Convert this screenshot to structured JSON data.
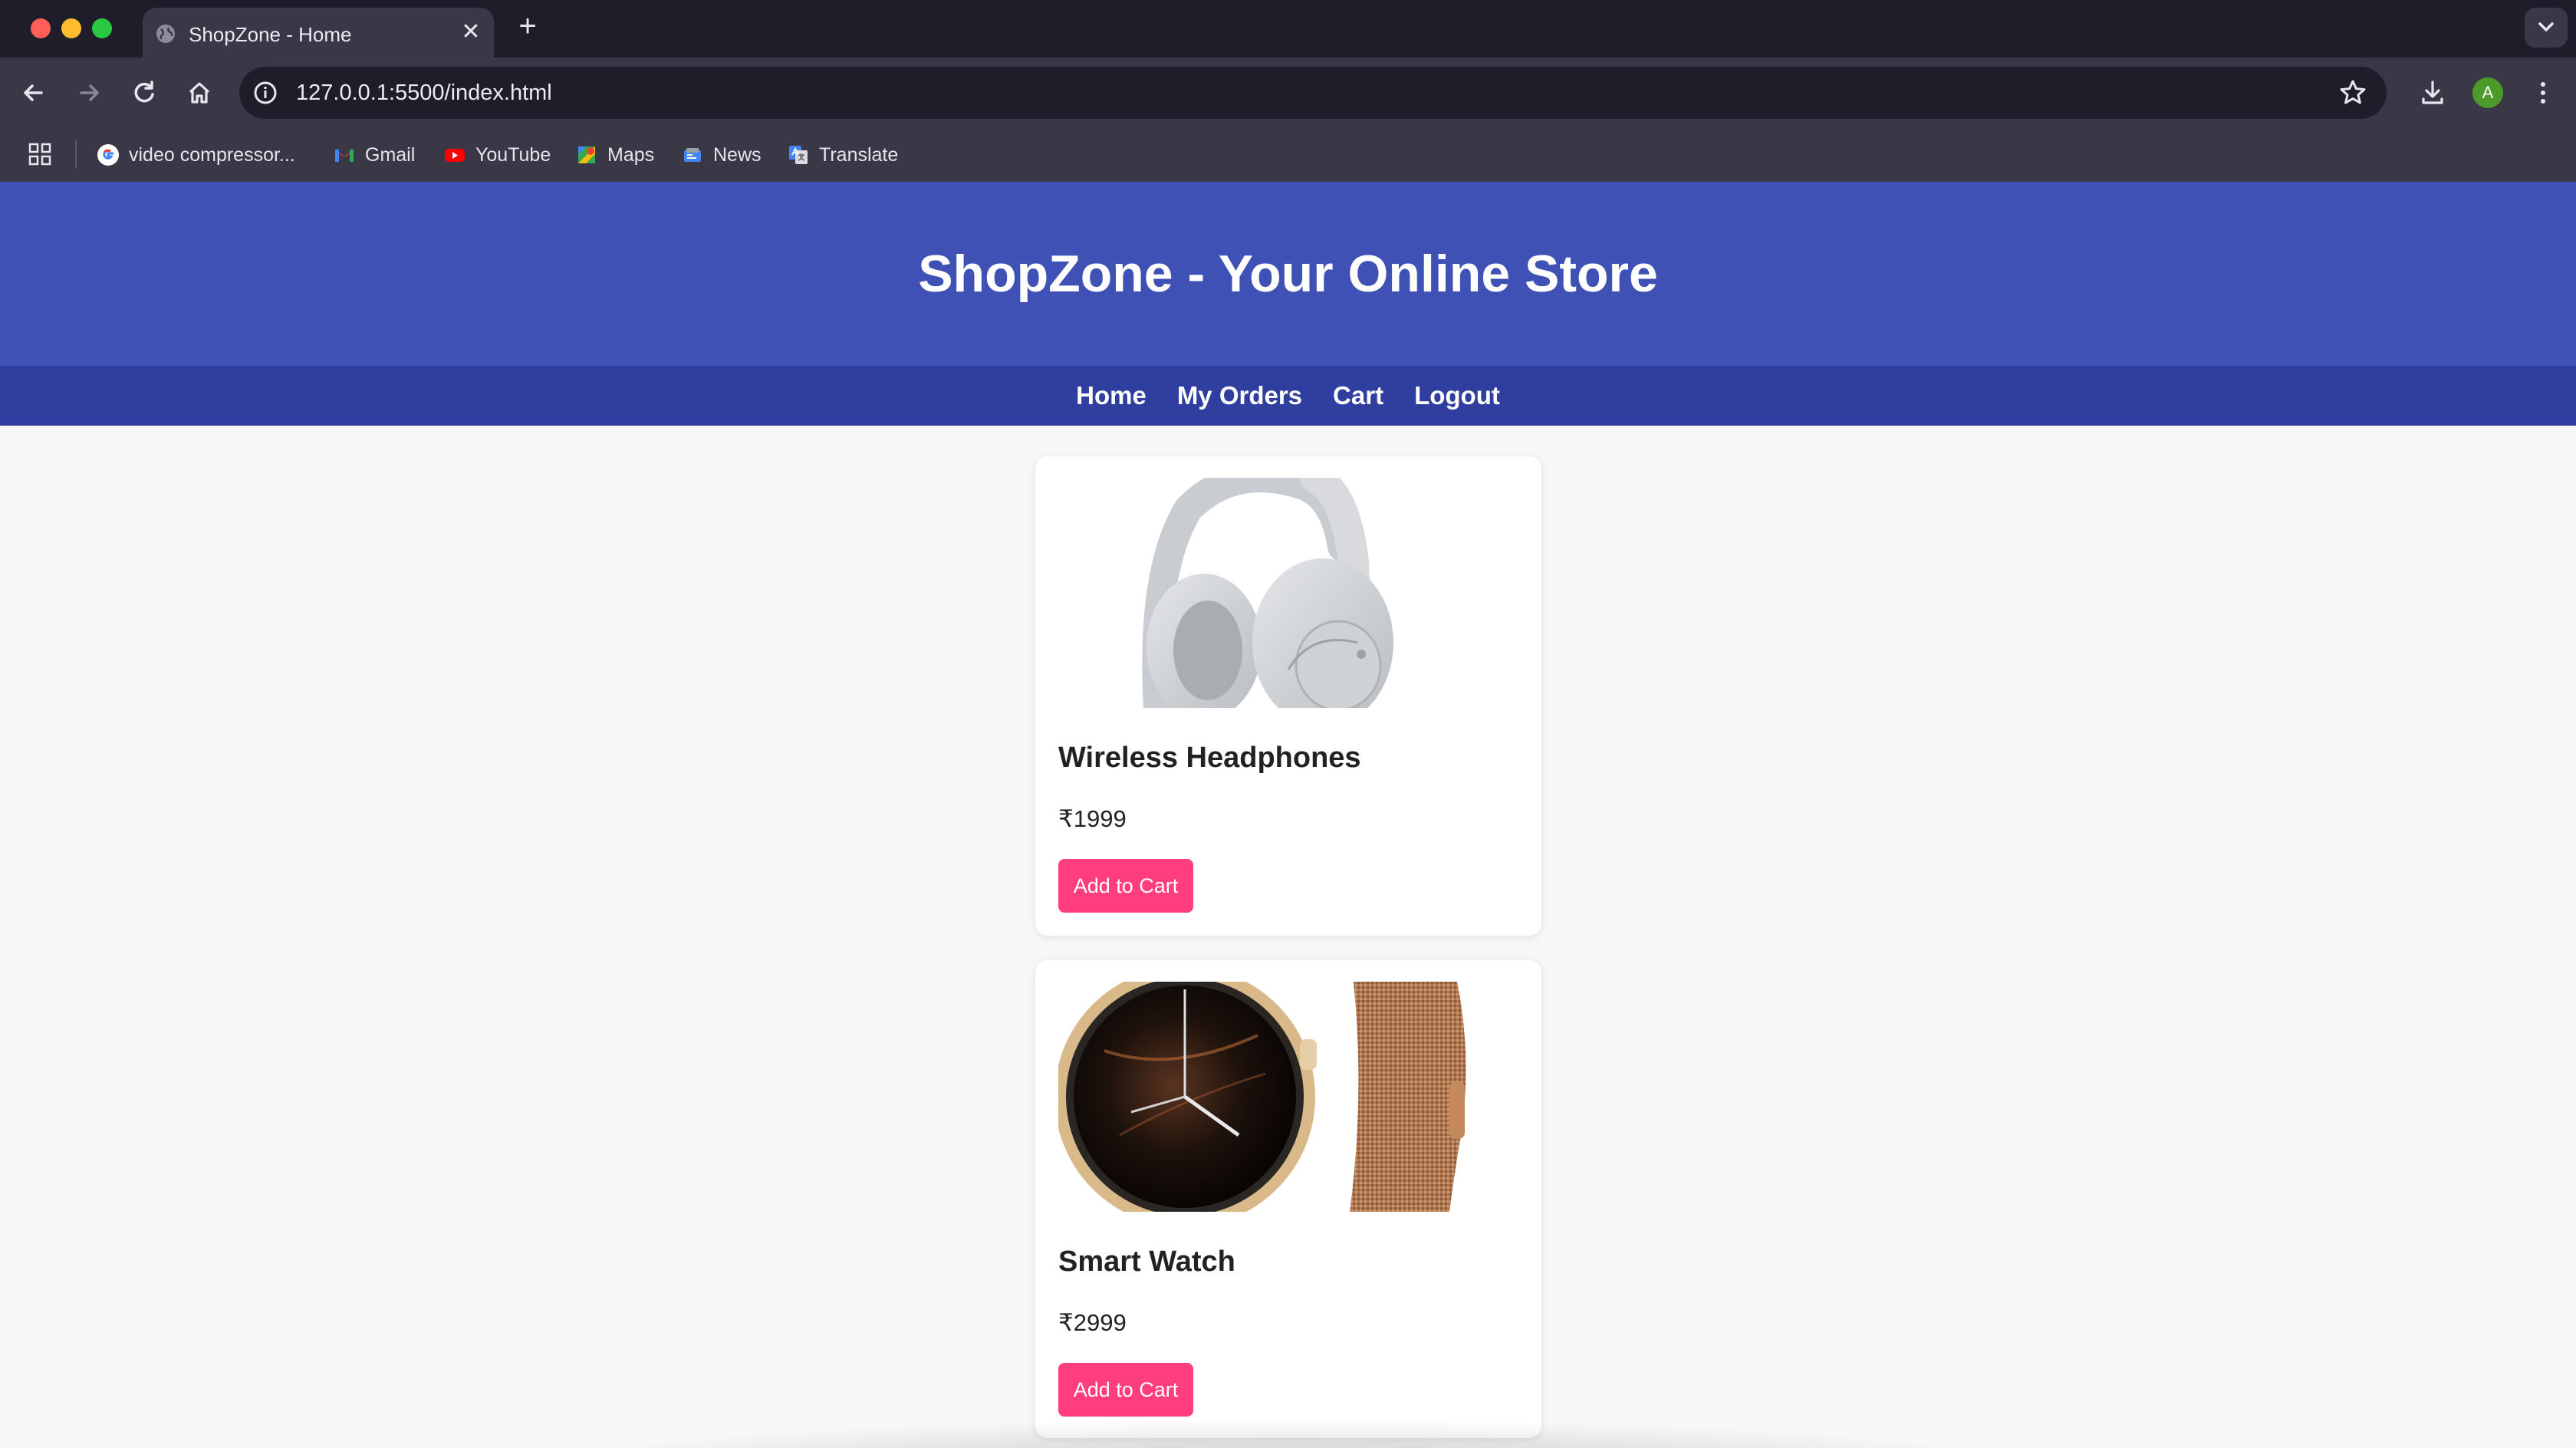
{
  "browser": {
    "tab_title": "ShopZone - Home",
    "tab_close": "✕",
    "new_tab": "+",
    "url": "127.0.0.1:5500/index.html",
    "profile_initial": "A",
    "bookmarks": [
      "video compressor...",
      "Gmail",
      "YouTube",
      "Maps",
      "News",
      "Translate"
    ]
  },
  "site": {
    "title": "ShopZone - Your Online Store",
    "nav": [
      "Home",
      "My Orders",
      "Cart",
      "Logout"
    ]
  },
  "products": [
    {
      "name": "Wireless Headphones",
      "price": "₹1999",
      "button": "Add to Cart"
    },
    {
      "name": "Smart Watch",
      "price": "₹2999",
      "button": "Add to Cart"
    }
  ],
  "colors": {
    "header": "#3f51b5",
    "nav": "#303f9f",
    "button": "#ff3d7f"
  }
}
